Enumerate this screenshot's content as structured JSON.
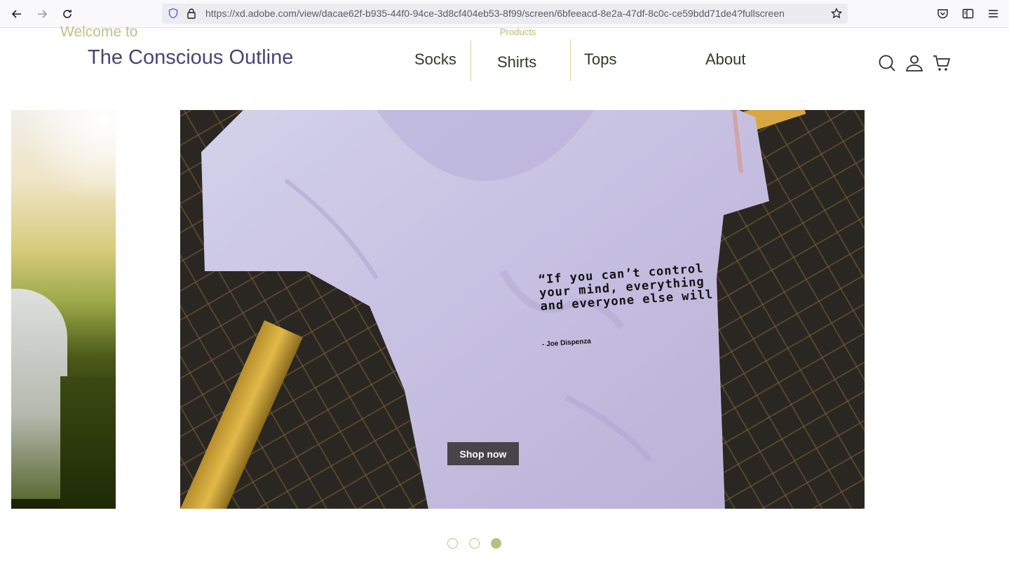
{
  "browser": {
    "url": "https://xd.adobe.com/view/dacae62f-b935-44f0-94ce-3d8cf404eb53-8f99/screen/6bfeeacd-8e2a-47df-8c0c-ce59bdd71de4?fullscreen"
  },
  "header": {
    "welcome": "Welcome to",
    "brand": "The Conscious Outline",
    "products_label": "Products",
    "nav": [
      "Socks",
      "Shirts",
      "Tops",
      "About"
    ],
    "icons": [
      "search-icon",
      "user-icon",
      "cart-icon"
    ]
  },
  "hero": {
    "quote": "“If you can’t control your mind, everything and everyone else will",
    "quote_author": "- Joe Dispenza",
    "cta": "Shop now"
  },
  "carousel": {
    "slide_count": 3,
    "active_index": 2
  },
  "colors": {
    "brand": "#4b4377",
    "welcome": "#c2bf8a",
    "nav_text": "#2f3a26",
    "accent": "#b9c07e",
    "cta_bg": "#47444a"
  }
}
